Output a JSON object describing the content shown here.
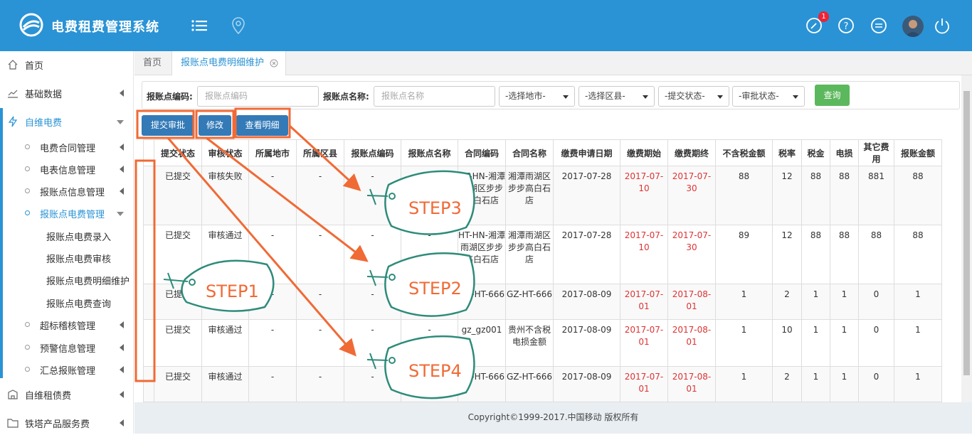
{
  "app": {
    "title": "电费租费管理系统",
    "notification_count": "1"
  },
  "sidebar": {
    "items": [
      {
        "label": "首页"
      },
      {
        "label": "基础数据"
      },
      {
        "label": "自维电费"
      },
      {
        "label": "电费合同管理"
      },
      {
        "label": "电表信息管理"
      },
      {
        "label": "报账点信息管理"
      },
      {
        "label": "报账点电费管理"
      },
      {
        "label": "报账点电费录入"
      },
      {
        "label": "报账点电费审核"
      },
      {
        "label": "报账点电费明细维护"
      },
      {
        "label": "报账点电费查询"
      },
      {
        "label": "超标稽核管理"
      },
      {
        "label": "预警信息管理"
      },
      {
        "label": "汇总报账管理"
      },
      {
        "label": "自维租债费"
      },
      {
        "label": "铁塔产品服务费"
      }
    ]
  },
  "tabs": [
    {
      "label": "首页"
    },
    {
      "label": "报账点电费明细维护"
    }
  ],
  "filter": {
    "code_label": "报账点编码:",
    "code_placeholder": "报账点编码",
    "name_label": "报账点名称:",
    "name_placeholder": "报账点名称",
    "city": "-选择地市-",
    "county": "-选择区县-",
    "submit_state": "-提交状态-",
    "approve_state": "-审批状态-",
    "query": "查询"
  },
  "actions": {
    "submit": "提交审批",
    "edit": "修改",
    "view": "查看明细"
  },
  "table": {
    "headers": [
      "提交状态",
      "审核状态",
      "所属地市",
      "所属区县",
      "报账点编码",
      "报账点名称",
      "合同编码",
      "合同名称",
      "缴费申请日期",
      "缴费期始",
      "缴费期终",
      "不含税金额",
      "税率",
      "税金",
      "电损",
      "其它费用",
      "报账金额"
    ],
    "rows": [
      [
        "已提交",
        "审核失败",
        "-",
        "-",
        "-",
        "-",
        "HT-HN-湘潭雨湖区步步高白石店",
        "湘潭雨湖区步步高白石店",
        "2017-07-28",
        "2017-07-10",
        "2017-07-30",
        "88",
        "12",
        "88",
        "88",
        "881",
        "88"
      ],
      [
        "已提交",
        "审核通过",
        "-",
        "-",
        "-",
        "-",
        "HT-HN-湘潭雨湖区步步高白石店",
        "湘潭雨湖区步步高白石店",
        "2017-07-28",
        "2017-07-10",
        "2017-07-30",
        "89",
        "12",
        "88",
        "88",
        "88",
        "88"
      ],
      [
        "已提交",
        "审核通过",
        "-",
        "-",
        "-",
        "-",
        "GZ-HT-666",
        "GZ-HT-666",
        "2017-08-09",
        "2017-07-01",
        "2017-08-01",
        "1",
        "2",
        "1",
        "1",
        "0",
        "1"
      ],
      [
        "已提交",
        "审核通过",
        "-",
        "-",
        "-",
        "-",
        "gz_gz001",
        "贵州不含税电损金额",
        "2017-08-09",
        "2017-07-01",
        "2017-08-01",
        "1",
        "10",
        "1",
        "1",
        "0",
        "1"
      ],
      [
        "已提交",
        "审核通过",
        "-",
        "-",
        "-",
        "-",
        "GZ-HT-666",
        "GZ-HT-666",
        "2017-08-09",
        "2017-07-01",
        "2017-08-01",
        "1",
        "2",
        "1",
        "1",
        "0",
        "1"
      ]
    ]
  },
  "annotations": {
    "step1": "STEP1",
    "step2": "STEP2",
    "step3": "STEP3",
    "step4": "STEP4",
    "accent": "#f06a35",
    "tag_color": "#2e8b7a"
  },
  "footer": {
    "copyright": "Copyright©1999-2017.中国移动 版权所有"
  }
}
